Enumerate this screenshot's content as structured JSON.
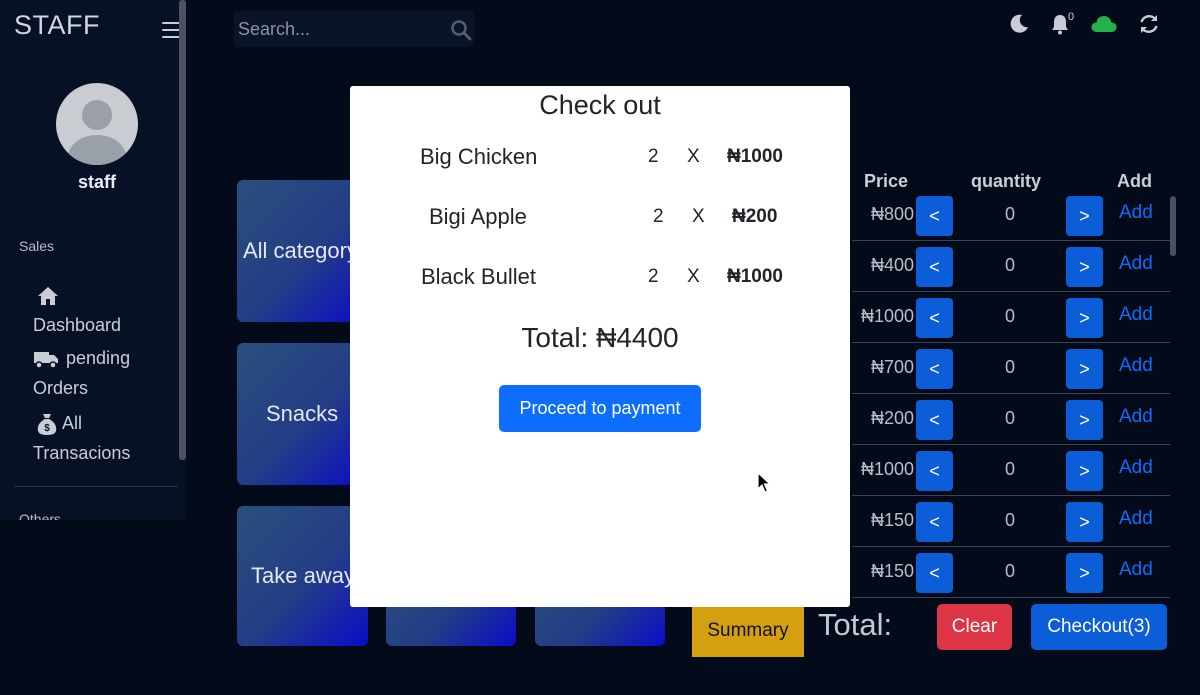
{
  "sidebar": {
    "brand": "STAFF",
    "username": "staff",
    "sections": {
      "sales": "Sales",
      "others": "Others"
    },
    "items": [
      {
        "label": "Dashboard",
        "icon": "home-icon"
      },
      {
        "label_line1": "pending",
        "label_line2": "Orders",
        "icon": "truck-icon"
      },
      {
        "label_line1": "All",
        "label_line2": "Transacions",
        "icon": "money-bag-icon"
      }
    ]
  },
  "topbar": {
    "search_placeholder": "Search...",
    "notification_count": "0",
    "icons": [
      "moon-icon",
      "bell-icon",
      "cloud-icon",
      "refresh-icon"
    ],
    "cloud_color": "#22b14c"
  },
  "categories": [
    "All category",
    "Snacks",
    "Take away",
    "",
    "",
    ""
  ],
  "table": {
    "headers": {
      "price": "Price",
      "quantity": "quantity",
      "add": "Add"
    },
    "rows": [
      {
        "price": "₦800",
        "qty": "0"
      },
      {
        "price": "₦400",
        "qty": "0"
      },
      {
        "price": "₦1000",
        "qty": "0"
      },
      {
        "price": "₦700",
        "qty": "0"
      },
      {
        "price": "₦200",
        "qty": "0"
      },
      {
        "price": "₦1000",
        "qty": "0"
      },
      {
        "price": "₦150",
        "qty": "0"
      },
      {
        "price": "₦150",
        "qty": "0"
      }
    ],
    "dec_label": "<",
    "inc_label": ">",
    "add_label": "Add"
  },
  "bottom": {
    "summary_label": "Summary",
    "total_label": "Total:",
    "clear_label": "Clear",
    "checkout_label": "Checkout(3)"
  },
  "modal": {
    "title": "Check out",
    "items": [
      {
        "name": "Big Chicken",
        "qty": "2",
        "x": "X",
        "price": "₦1000"
      },
      {
        "name": "Bigi Apple",
        "qty": "2",
        "x": "X",
        "price": "₦200"
      },
      {
        "name": "Black Bullet",
        "qty": "2",
        "x": "X",
        "price": "₦1000"
      }
    ],
    "total": "Total: ₦4400",
    "pay_button": "Proceed to payment"
  },
  "colors": {
    "background": "#030a1a",
    "primary": "#0d6efd",
    "danger": "#dc3545",
    "warning": "#d4a00f"
  }
}
